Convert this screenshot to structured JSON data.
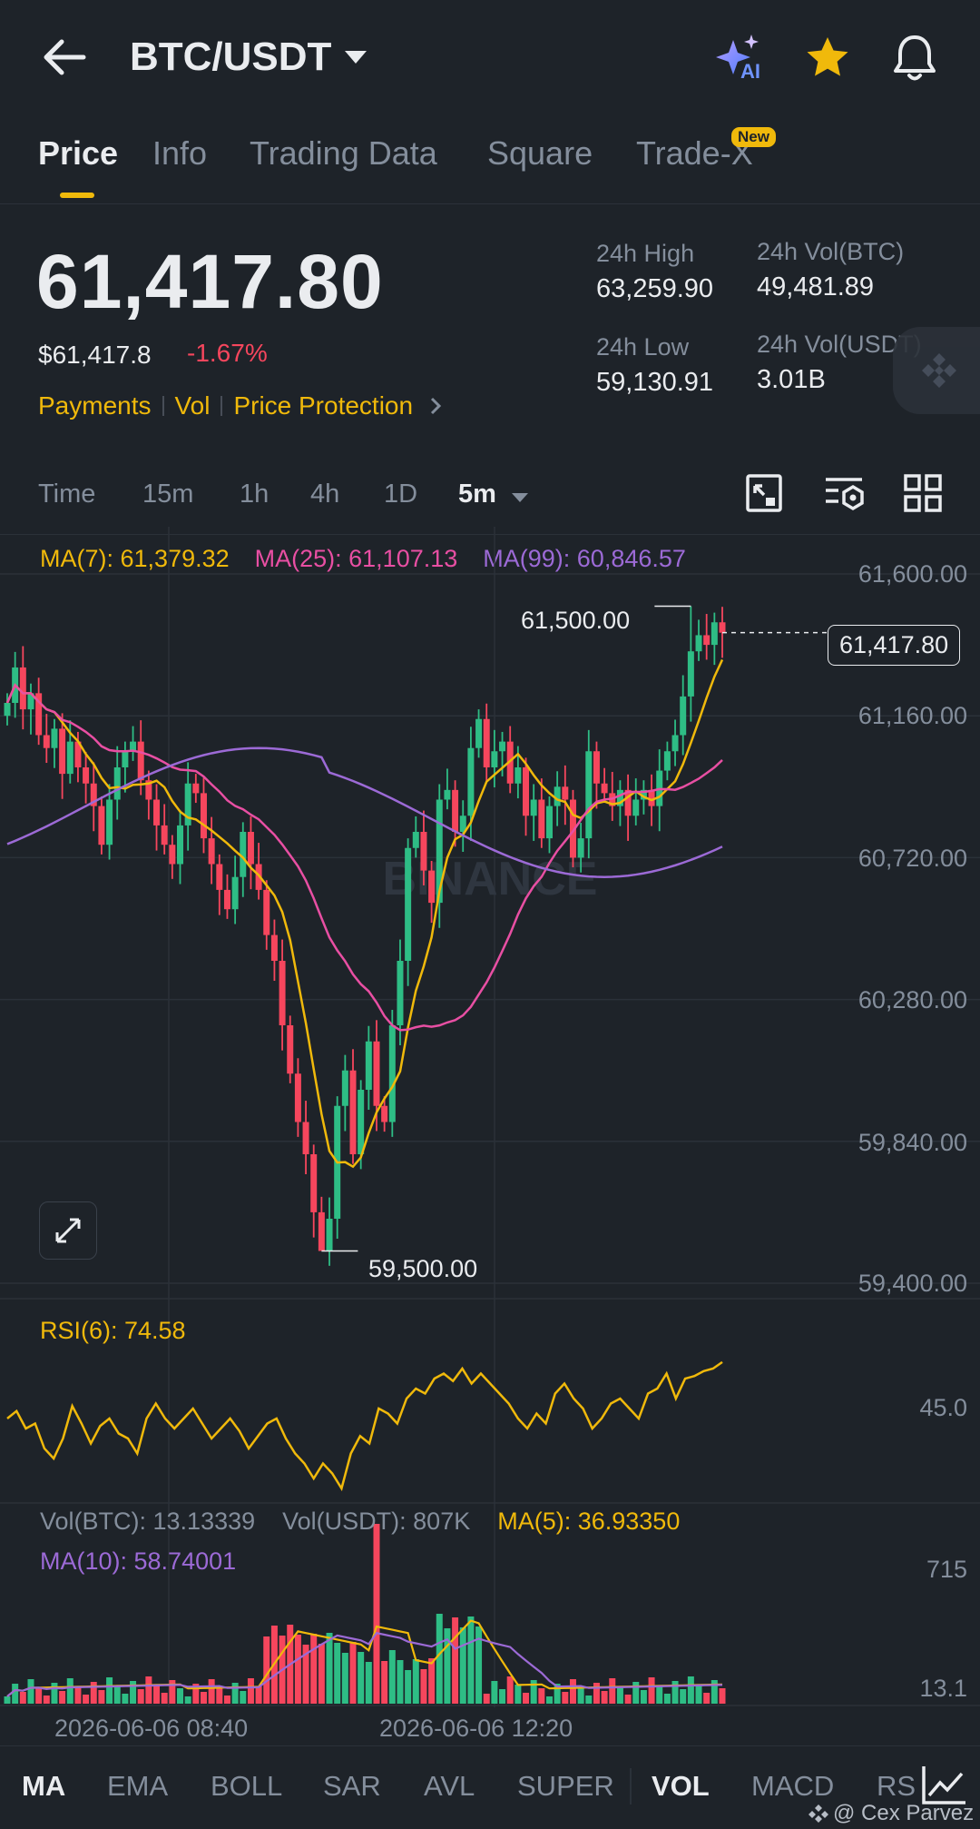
{
  "header": {
    "pair": "BTC/USDT",
    "ai_badge": "AI"
  },
  "tabs": [
    {
      "label": "Price",
      "active": true
    },
    {
      "label": "Info"
    },
    {
      "label": "Trading Data"
    },
    {
      "label": "Square"
    },
    {
      "label": "Trade-X",
      "badge": "New"
    }
  ],
  "ticker": {
    "last_price": "61,417.80",
    "usd_price": "$61,417.8",
    "change_pct": "-1.67%",
    "links": [
      "Payments",
      "Vol",
      "Price Protection"
    ],
    "high_label": "24h High",
    "high": "63,259.90",
    "low_label": "24h Low",
    "low": "59,130.91",
    "vol_btc_label": "24h Vol(BTC)",
    "vol_btc": "49,481.89",
    "vol_usdt_label": "24h Vol(USDT)",
    "vol_usdt": "3.01B"
  },
  "intervals": {
    "time": "Time",
    "items": [
      "15m",
      "1h",
      "4h",
      "1D"
    ],
    "selected": "5m"
  },
  "ma_legend": {
    "ma7": "MA(7): 61,379.32",
    "ma25": "MA(25): 61,107.13",
    "ma99": "MA(99): 60,846.57"
  },
  "price_axis": [
    "61,600.00",
    "61,160.00",
    "60,720.00",
    "60,280.00",
    "59,840.00",
    "59,400.00"
  ],
  "current_price_tag": "61,417.80",
  "high_marker": "61,500.00",
  "low_marker": "59,500.00",
  "watermark": "BINANCE",
  "rsi": {
    "label": "RSI(6): 74.58",
    "axis": "45.0"
  },
  "volume": {
    "vol_btc": "Vol(BTC): 13.13339",
    "vol_usdt": "Vol(USDT): 807K",
    "ma5": "MA(5): 36.93350",
    "ma10": "MA(10): 58.74001",
    "axis_top": "715",
    "axis_bottom": "13.1"
  },
  "time_axis": [
    "2026-06-06 08:40",
    "2026-06-06 12:20"
  ],
  "indicators": [
    "MA",
    "EMA",
    "BOLL",
    "SAR",
    "AVL",
    "SUPER",
    "VOL",
    "MACD",
    "RSI"
  ],
  "active_indicators": [
    "MA",
    "VOL"
  ],
  "credit": "@ Cex Parvez",
  "colors": {
    "up": "#2ebd85",
    "down": "#f6465d",
    "accent": "#f0b90b",
    "ma25": "#e84fa3",
    "ma99": "#9c6ad6"
  },
  "chart_data": {
    "type": "candlestick",
    "interval": "5m",
    "ylim": [
      59400,
      61600
    ],
    "closes": [
      61200,
      61310,
      61180,
      61230,
      61100,
      61060,
      61120,
      60980,
      61080,
      61000,
      60950,
      60880,
      60760,
      60900,
      61000,
      61050,
      61080,
      60960,
      60900,
      60820,
      60760,
      60700,
      60820,
      60950,
      60920,
      60780,
      60700,
      60620,
      60560,
      60660,
      60800,
      60700,
      60620,
      60480,
      60400,
      60200,
      60050,
      59900,
      59800,
      59620,
      59500,
      59600,
      59950,
      60060,
      59800,
      60000,
      60150,
      59950,
      59900,
      60200,
      60400,
      60750,
      60800,
      60680,
      60580,
      60900,
      60930,
      60800,
      60850,
      61060,
      61150,
      61000,
      61050,
      61080,
      60950,
      61000,
      60850,
      60900,
      60780,
      60880,
      60940,
      60900,
      60720,
      60780,
      61050,
      60950,
      60920,
      60880,
      60930,
      60850,
      60900,
      60930,
      60880,
      60990,
      61050,
      61100,
      61220,
      61360,
      61410,
      61380,
      61450,
      61417.8
    ],
    "high": 61500,
    "low": 59500,
    "rsi6": [
      52,
      55,
      48,
      50,
      40,
      36,
      44,
      57,
      50,
      42,
      49,
      52,
      46,
      44,
      38,
      52,
      58,
      52,
      48,
      52,
      56,
      50,
      44,
      48,
      52,
      47,
      40,
      45,
      50,
      52,
      44,
      38,
      34,
      28,
      34,
      30,
      24,
      38,
      45,
      42,
      56,
      54,
      50,
      60,
      64,
      62,
      68,
      70,
      67,
      72,
      66,
      70,
      66,
      62,
      58,
      52,
      48,
      54,
      50,
      62,
      66,
      60,
      56,
      48,
      52,
      58,
      60,
      56,
      52,
      62,
      64,
      70,
      60,
      68,
      69,
      71,
      72,
      74.58
    ]
  }
}
